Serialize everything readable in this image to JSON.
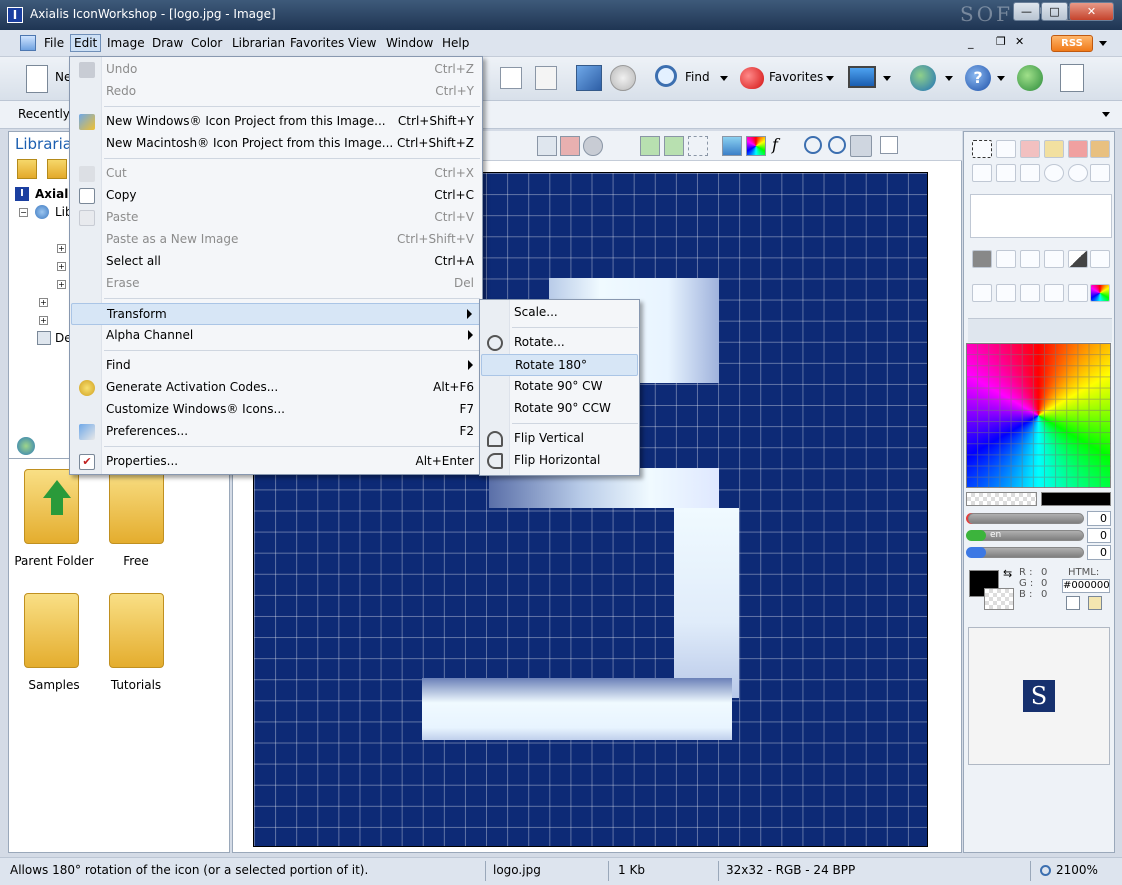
{
  "window": {
    "title": "Axialis IconWorkshop - [logo.jpg - Image]",
    "app_icon_letter": "I",
    "watermark": "SOFTPEDIA",
    "controls": {
      "minimize": "—",
      "maximize": "□",
      "close": "✕"
    },
    "inner_controls": {
      "minimize": "_",
      "restore": "❐",
      "close": "✕"
    }
  },
  "menubar": {
    "items": [
      "File",
      "Edit",
      "Image",
      "Draw",
      "Color",
      "Librarian",
      "Favorites",
      "View",
      "Window",
      "Help"
    ],
    "rss": "RSS"
  },
  "toolbar": {
    "new_label": "Ne",
    "find_label": "Find",
    "favorites_label": "Favorites"
  },
  "addressbar": {
    "recent_label": "Recently U"
  },
  "left_panel": {
    "title": "Librarian",
    "tree": [
      {
        "label": "Axialis",
        "level": 0
      },
      {
        "label": "Lib",
        "level": 1
      },
      {
        "label": "De",
        "level": 1
      }
    ]
  },
  "file_browser": {
    "items": [
      {
        "label": "Parent Folder",
        "type": "parent"
      },
      {
        "label": "Free",
        "type": "folder"
      },
      {
        "label": "Samples",
        "type": "folder"
      },
      {
        "label": "Tutorials",
        "type": "folder"
      }
    ]
  },
  "edit_menu": {
    "items": [
      {
        "label": "Undo",
        "shortcut": "Ctrl+Z",
        "enabled": false,
        "icon": "undo-icon"
      },
      {
        "label": "Redo",
        "shortcut": "Ctrl+Y",
        "enabled": false
      },
      {
        "label": "New Windows® Icon Project from this Image...",
        "shortcut": "Ctrl+Shift+Y",
        "enabled": true,
        "icon": "windows-project-icon"
      },
      {
        "label": "New Macintosh® Icon Project from this Image...",
        "shortcut": "Ctrl+Shift+Z",
        "enabled": true
      },
      {
        "label": "Cut",
        "shortcut": "Ctrl+X",
        "enabled": false,
        "icon": "cut-icon"
      },
      {
        "label": "Copy",
        "shortcut": "Ctrl+C",
        "enabled": true,
        "icon": "copy-icon"
      },
      {
        "label": "Paste",
        "shortcut": "Ctrl+V",
        "enabled": false,
        "icon": "paste-icon"
      },
      {
        "label": "Paste as a New Image",
        "shortcut": "Ctrl+Shift+V",
        "enabled": false
      },
      {
        "label": "Select all",
        "shortcut": "Ctrl+A",
        "enabled": true
      },
      {
        "label": "Erase",
        "shortcut": "Del",
        "enabled": false
      },
      {
        "label": "Transform",
        "shortcut": "",
        "enabled": true,
        "submenu": true,
        "highlighted": true
      },
      {
        "label": "Alpha Channel",
        "shortcut": "",
        "enabled": true,
        "submenu": true
      },
      {
        "label": "Find",
        "shortcut": "",
        "enabled": true,
        "submenu": true
      },
      {
        "label": "Generate Activation Codes...",
        "shortcut": "Alt+F6",
        "enabled": true,
        "icon": "key-icon"
      },
      {
        "label": "Customize Windows® Icons...",
        "shortcut": "F7",
        "enabled": true
      },
      {
        "label": "Preferences...",
        "shortcut": "F2",
        "enabled": true,
        "icon": "preferences-icon"
      },
      {
        "label": "Properties...",
        "shortcut": "Alt+Enter",
        "enabled": true,
        "icon": "properties-icon"
      }
    ]
  },
  "transform_submenu": {
    "items": [
      {
        "label": "Scale...",
        "icon": ""
      },
      {
        "label": "Rotate...",
        "icon": "rotate-icon"
      },
      {
        "label": "Rotate 180°",
        "highlighted": true
      },
      {
        "label": "Rotate 90° CW"
      },
      {
        "label": "Rotate 90° CCW"
      },
      {
        "label": "Flip Vertical",
        "icon": "flip-vertical-icon"
      },
      {
        "label": "Flip Horizontal",
        "icon": "flip-horizontal-icon"
      }
    ]
  },
  "canvas": {
    "grid_size": 32,
    "pixel_color": "#0d2a76",
    "highlight_color": "#e8f4ff"
  },
  "right_panel": {
    "slider_values": [
      "0",
      "0",
      "0"
    ],
    "slider_labels": [
      "",
      "en",
      ""
    ],
    "rgb_labels": {
      "r": "R :",
      "g": "G :",
      "b": "B :"
    },
    "rgb_values": {
      "r": "0",
      "g": "0",
      "b": "0"
    },
    "html_label": "HTML:",
    "html_value": "#000000",
    "preview_letter": "S"
  },
  "statusbar": {
    "hint": "Allows 180° rotation of the icon (or a selected portion of it).",
    "filename": "logo.jpg",
    "size": "1 Kb",
    "format": "32x32 - RGB - 24 BPP",
    "zoom": "2100%"
  }
}
